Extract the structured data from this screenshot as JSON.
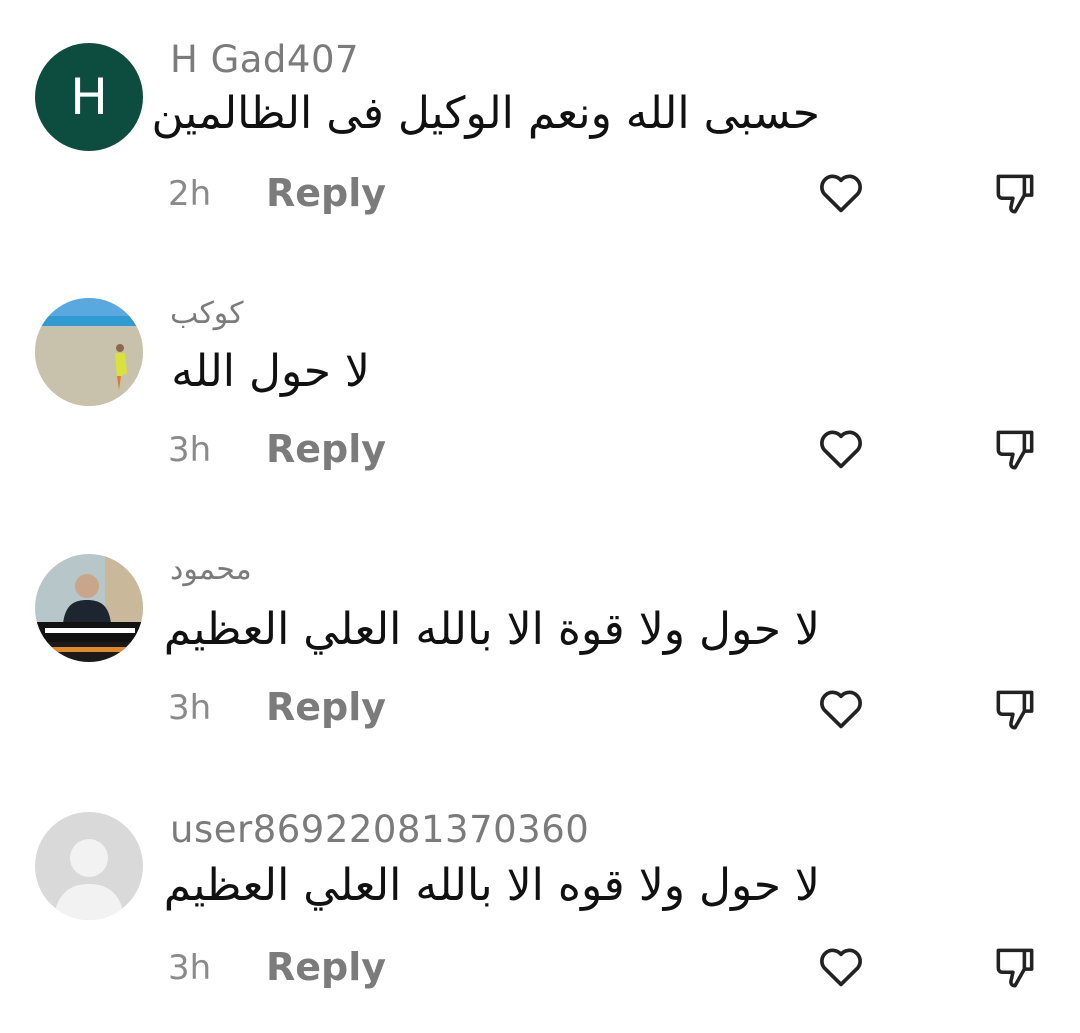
{
  "comments": [
    {
      "username": "H Gad407",
      "avatar_letter": "H",
      "text": "حسبى الله ونعم الوكيل فى الظالمين",
      "time": "2h",
      "reply_label": "Reply",
      "like_icon": "heart-outline",
      "dislike_icon": "thumbs-down-outline"
    },
    {
      "username": "كوكب",
      "text": "لا حول الله",
      "time": "3h",
      "reply_label": "Reply",
      "like_icon": "heart-outline",
      "dislike_icon": "thumbs-down-outline"
    },
    {
      "username": "محمود",
      "text": "لا حول ولا قوة الا بالله العلي العظيم",
      "time": "3h",
      "reply_label": "Reply",
      "like_icon": "heart-outline",
      "dislike_icon": "thumbs-down-outline"
    },
    {
      "username": "user86922081370360",
      "text": "لا حول ولا قوه الا بالله العلي العظيم",
      "time": "3h",
      "reply_label": "Reply",
      "like_icon": "heart-outline",
      "dislike_icon": "thumbs-down-outline"
    }
  ],
  "colors": {
    "avatar_green": "#0d4d3f",
    "meta_gray": "#7b7b7b",
    "text_black": "#111111"
  }
}
